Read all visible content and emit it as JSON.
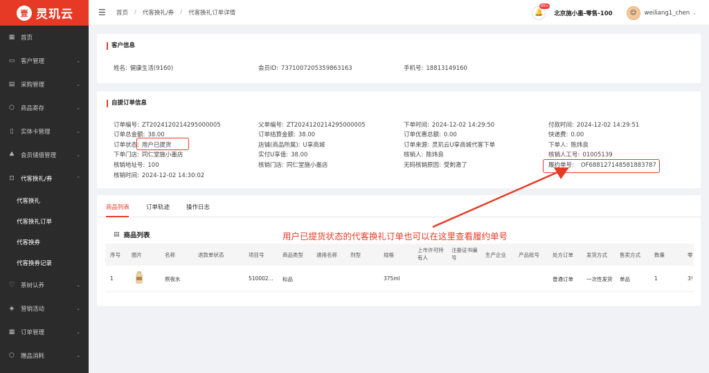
{
  "app": {
    "logo_mark": "壹",
    "logo_text": "灵玑云"
  },
  "sidebar": {
    "items": [
      {
        "icon": "▦",
        "label": "首页",
        "chevron": ""
      },
      {
        "icon": "▭",
        "label": "客户管理",
        "chevron": "⌄"
      },
      {
        "icon": "▤",
        "label": "采购管理",
        "chevron": "⌄"
      },
      {
        "icon": "⬡",
        "label": "商品寄存",
        "chevron": "⌄"
      },
      {
        "icon": "▯",
        "label": "实体卡管理",
        "chevron": "⌄"
      },
      {
        "icon": "♣",
        "label": "会员储值管理",
        "chevron": "⌄"
      },
      {
        "icon": "⊡",
        "label": "代客换礼/券",
        "chevron": "⌃"
      }
    ],
    "subitems": [
      "代客换礼",
      "代客换礼订单",
      "代客换券",
      "代客换券记录"
    ],
    "items_after": [
      {
        "icon": "♡",
        "label": "茶树认养",
        "chevron": "⌄"
      },
      {
        "icon": "◈",
        "label": "营销活动",
        "chevron": "⌄"
      },
      {
        "icon": "▦",
        "label": "订单管理",
        "chevron": "⌄"
      },
      {
        "icon": "⬡",
        "label": "赠品消耗",
        "chevron": "⌄"
      }
    ]
  },
  "header": {
    "hamburger": "☰",
    "breadcrumb": [
      "首页",
      "代客换礼/券",
      "代客换礼订单详情"
    ],
    "separator": "/",
    "bell_badge": "99+",
    "store": "北京施小墨-零售-100",
    "user": "weiliang1_chen"
  },
  "customer": {
    "title": "客户信息",
    "name_label": "姓名:",
    "name": "健康生活(9160)",
    "member_label": "会员ID:",
    "member": "7371007205359863163",
    "phone_label": "手机号:",
    "phone": "18813149160"
  },
  "order": {
    "title": "自提订单信息",
    "fields": {
      "order_no": {
        "k": "订单编号:",
        "v": "ZT2024120214295000005"
      },
      "total": {
        "k": "订单总金额:",
        "v": "38.00"
      },
      "status": {
        "k": "订单状态:",
        "v": "用户已提货"
      },
      "store": {
        "k": "下单门店:",
        "v": "同仁堂施小墨店"
      },
      "verify_addr": {
        "k": "核销地址号:",
        "v": "100"
      },
      "verify_time": {
        "k": "核销时间:",
        "v": "2024-12-02 14:30:02"
      },
      "parent_no": {
        "k": "父单编号:",
        "v": "ZT2024120214295000005"
      },
      "settle": {
        "k": "订单结算金额:",
        "v": "38.00"
      },
      "shop": {
        "k": "店铺(商品所属):",
        "v": "U享商城"
      },
      "actual": {
        "k": "实付U享值:",
        "v": "38.00"
      },
      "verify_store": {
        "k": "核销门店:",
        "v": "同仁堂施小墨店"
      },
      "order_time": {
        "k": "下单时间:",
        "v": "2024-12-02 14:29:50"
      },
      "discount": {
        "k": "订单优惠总额:",
        "v": "0.00"
      },
      "source": {
        "k": "订单来源:",
        "v": "灵玑云U享商城代客下单"
      },
      "verifier": {
        "k": "核销人:",
        "v": "陈炜良"
      },
      "no_code_reason": {
        "k": "无码核销原因:",
        "v": "受刺激了"
      },
      "pay_time": {
        "k": "付款时间:",
        "v": "2024-12-02 14:29:51"
      },
      "shipping": {
        "k": "快递费:",
        "v": "0.00"
      },
      "placer": {
        "k": "下单人:",
        "v": "陈炜良"
      },
      "verifier_id": {
        "k": "核销人工号:",
        "v": "01005139"
      },
      "delivery_no": {
        "k": "履约单号:",
        "v": "OF688127148581883787"
      }
    }
  },
  "tabs": [
    "商品列表",
    "订单轨迹",
    "操作日志"
  ],
  "product_list": {
    "title": "商品列表",
    "headers": [
      "序号",
      "图片",
      "名称",
      "退款单状态",
      "项目号",
      "商品类型",
      "通用名称",
      "剂型",
      "规格",
      "上市许可持\n有人",
      "注册证书编\n号",
      "生产企业",
      "产品批号",
      "处方订单",
      "发货方式",
      "售卖方式",
      "数量",
      "零"
    ],
    "row": [
      "1",
      "",
      "熬夜水",
      "",
      "510002...",
      "标品",
      "",
      "",
      "375ml",
      "",
      "",
      "",
      "",
      "普通订单",
      "一次性发货",
      "单品",
      "1",
      "3!"
    ]
  },
  "annotation": "用户已提货状态的代客换礼订单也可以在这里查看履约单号",
  "colors": {
    "accent": "#e63a26",
    "sidebar": "#2b2b2b"
  }
}
